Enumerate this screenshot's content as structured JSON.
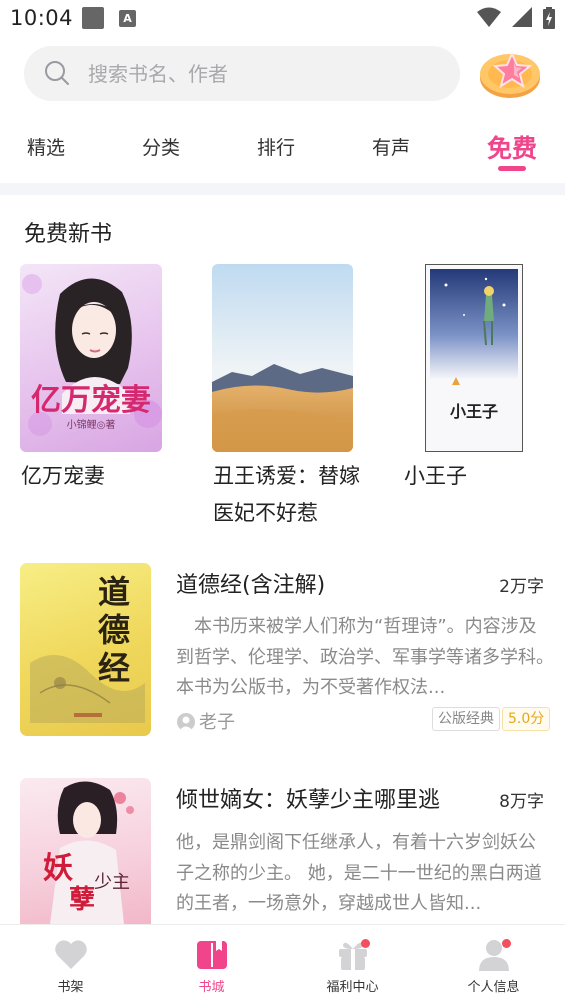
{
  "status_bar": {
    "time": "10:04",
    "a_icon_letter": "A"
  },
  "search": {
    "placeholder": "搜索书名、作者"
  },
  "tabs": [
    {
      "label": "精选"
    },
    {
      "label": "分类"
    },
    {
      "label": "排行"
    },
    {
      "label": "有声"
    },
    {
      "label": "免费",
      "active": true
    }
  ],
  "section": {
    "title": "免费新书"
  },
  "featured_books": [
    {
      "title": "亿万宠妻",
      "cover_text": "亿万宠妻",
      "cover_author": "小锦鲤◎著"
    },
    {
      "title": "丑王诱爱：替嫁医妃不好惹"
    },
    {
      "title": "小王子",
      "cover_text": "小王子"
    }
  ],
  "list_books": [
    {
      "title": "道德经(含注解)",
      "words": "2万字",
      "description": "本书历来被学人们称为“哲理诗”。内容涉及到哲学、伦理学、政治学、军事学等诸多学科。　本书为公版书，为不受著作权法...",
      "author": "老子",
      "tag": "公版经典",
      "score": "5.0分",
      "cover_text": "道德经"
    },
    {
      "title": "倾世嫡女：妖孽少主哪里逃",
      "words": "8万字",
      "description": "他，是鼎剑阁下任继承人，有着十六岁剑妖公子之称的少主。 她，是二十一世纪的黑白两道的王者，一场意外，穿越成世人皆知...",
      "cover_text": "妖孽少主"
    }
  ],
  "bottom_nav": [
    {
      "label": "书架",
      "icon": "heart-icon"
    },
    {
      "label": "书城",
      "icon": "book-icon",
      "active": true
    },
    {
      "label": "福利中心",
      "icon": "gift-icon",
      "badge": true
    },
    {
      "label": "个人信息",
      "icon": "user-icon",
      "badge": true
    }
  ],
  "colors": {
    "accent": "#f0458b",
    "badge": "#f24f5f",
    "score": "#e6a817"
  }
}
